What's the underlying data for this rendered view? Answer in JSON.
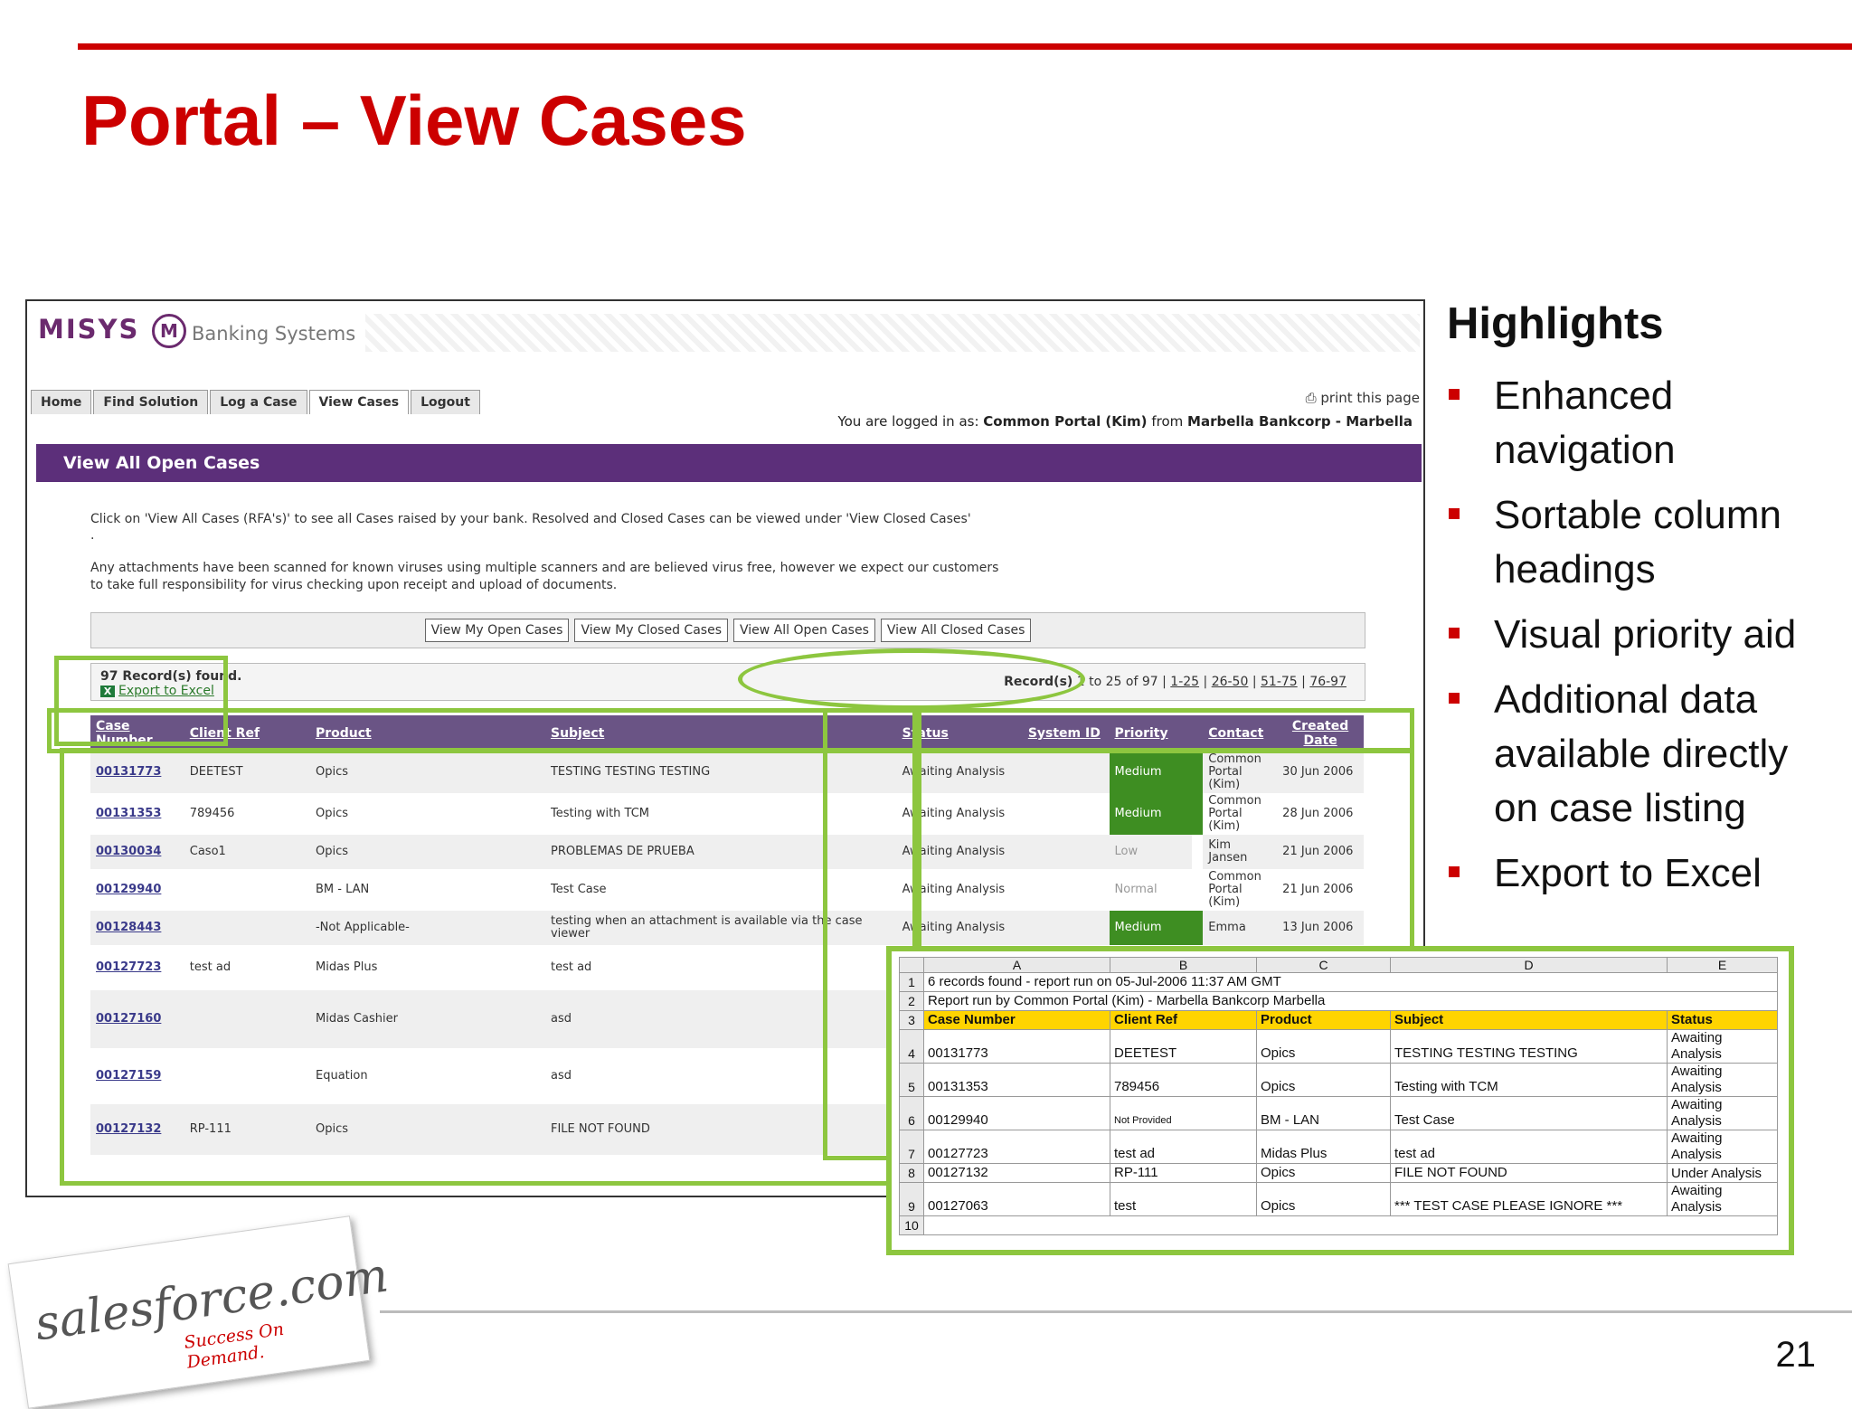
{
  "slide": {
    "title": "Portal – View Cases",
    "page_number": "21"
  },
  "portal": {
    "logo_text": "MISYS",
    "logo_mark": "M",
    "logo_subtitle": "Banking Systems",
    "tabs": [
      "Home",
      "Find Solution",
      "Log a Case",
      "View Cases",
      "Logout"
    ],
    "active_tab": "View Cases",
    "print_label": "print this page",
    "logged_in_prefix": "You are logged in as:",
    "logged_in_user": "Common Portal (Kim)",
    "logged_in_from": "from",
    "logged_in_org": "Marbella Bankcorp - Marbella",
    "section_title": "View All Open Cases",
    "intro_text": "Click on 'View All Cases (RFA's)' to see all Cases raised by your bank. Resolved and Closed Cases can be viewed under 'View Closed Cases'",
    "intro_dot": ".",
    "virus_text": "Any attachments have been scanned for known viruses using multiple scanners and are believed virus free, however we expect our customers to take full responsibility for virus checking upon receipt and upload of documents.",
    "view_buttons": [
      "View My Open Cases",
      "View My Closed Cases",
      "View All Open Cases",
      "View All Closed Cases"
    ],
    "records_found": "97 Record(s) found.",
    "export_label": "Export to Excel",
    "pager_prefix": "Record(s)",
    "pager_range": "1 to 25 of 97",
    "pager_links": [
      "1-25",
      "26-50",
      "51-75",
      "76-97"
    ],
    "columns": [
      "Case Number",
      "Client Ref",
      "Product",
      "Subject",
      "Status",
      "System ID",
      "Priority",
      "Contact",
      "Created Date"
    ],
    "rows": [
      {
        "number": "00131773",
        "client_ref": "DEETEST",
        "product": "Opics",
        "subject": "TESTING TESTING TESTING",
        "status": "Awaiting Analysis",
        "system_id": "",
        "priority": "Medium",
        "priority_level": "high",
        "contact": "Common Portal (Kim)",
        "created": "30 Jun 2006"
      },
      {
        "number": "00131353",
        "client_ref": "789456",
        "product": "Opics",
        "subject": "Testing with TCM",
        "status": "Awaiting Analysis",
        "system_id": "",
        "priority": "Medium",
        "priority_level": "high",
        "contact": "Common Portal (Kim)",
        "created": "28 Jun 2006"
      },
      {
        "number": "00130034",
        "client_ref": "Caso1",
        "product": "Opics",
        "subject": "PROBLEMAS DE PRUEBA",
        "status": "Awaiting Analysis",
        "system_id": "",
        "priority": "Low",
        "priority_level": "low",
        "contact": "Kim Jansen",
        "created": "21 Jun 2006"
      },
      {
        "number": "00129940",
        "client_ref": "",
        "product": "BM - LAN",
        "subject": "Test Case",
        "status": "Awaiting Analysis",
        "system_id": "",
        "priority": "Normal",
        "priority_level": "low",
        "contact": "Common Portal (Kim)",
        "created": "21 Jun 2006"
      },
      {
        "number": "00128443",
        "client_ref": "",
        "product": "-Not Applicable-",
        "subject": "testing when an attachment is available via the case viewer",
        "status": "Awaiting Analysis",
        "system_id": "",
        "priority": "Medium",
        "priority_level": "high",
        "contact": "Emma",
        "created": "13 Jun 2006"
      },
      {
        "number": "00127723",
        "client_ref": "test ad",
        "product": "Midas Plus",
        "subject": "test ad",
        "status": "",
        "system_id": "",
        "priority": "",
        "priority_level": "none",
        "contact": "",
        "created": ""
      },
      {
        "number": "00127160",
        "client_ref": "",
        "product": "Midas Cashier",
        "subject": "asd",
        "status": "",
        "system_id": "",
        "priority": "",
        "priority_level": "none",
        "contact": "",
        "created": ""
      },
      {
        "number": "00127159",
        "client_ref": "",
        "product": "Equation",
        "subject": "asd",
        "status": "",
        "system_id": "",
        "priority": "",
        "priority_level": "none",
        "contact": "",
        "created": ""
      },
      {
        "number": "00127132",
        "client_ref": "RP-111",
        "product": "Opics",
        "subject": "FILE NOT FOUND",
        "status": "",
        "system_id": "",
        "priority": "",
        "priority_level": "none",
        "contact": "",
        "created": ""
      }
    ]
  },
  "excel": {
    "col_letters": [
      "A",
      "B",
      "C",
      "D",
      "E"
    ],
    "line1": "6 records found - report run on 05-Jul-2006 11:37 AM GMT",
    "line2": "Report run by Common Portal (Kim) - Marbella Bankcorp Marbella",
    "headers": [
      "Case Number",
      "Client Ref",
      "Product",
      "Subject",
      "Status"
    ],
    "rows": [
      {
        "rownum": "4",
        "cells": [
          "00131773",
          "DEETEST",
          "Opics",
          "TESTING TESTING TESTING"
        ],
        "status": [
          "Awaiting",
          "Analysis"
        ]
      },
      {
        "rownum": "5",
        "cells": [
          "00131353",
          "789456",
          "Opics",
          "Testing with TCM"
        ],
        "status": [
          "Awaiting",
          "Analysis"
        ]
      },
      {
        "rownum": "6",
        "cells": [
          "00129940",
          "Not Provided",
          "BM - LAN",
          "Test Case"
        ],
        "status": [
          "Awaiting",
          "Analysis"
        ]
      },
      {
        "rownum": "7",
        "cells": [
          "00127723",
          "test ad",
          "Midas Plus",
          "test ad"
        ],
        "status": [
          "Awaiting",
          "Analysis"
        ]
      },
      {
        "rownum": "8",
        "cells": [
          "00127132",
          "RP-111",
          "Opics",
          "FILE NOT FOUND"
        ],
        "status": [
          "Under Analysis",
          ""
        ]
      },
      {
        "rownum": "9",
        "cells": [
          "00127063",
          "test",
          "Opics",
          "*** TEST CASE PLEASE IGNORE ***"
        ],
        "status": [
          "Awaiting",
          "Analysis"
        ]
      }
    ],
    "last_row": "10"
  },
  "highlights": {
    "title": "Highlights",
    "items": [
      "Enhanced navigation",
      "Sortable column headings",
      "Visual priority aid",
      "Additional data available directly on case listing",
      "Export to Excel"
    ]
  },
  "footer": {
    "brand": "salesforce.com",
    "tagline": "Success On Demand."
  },
  "colors": {
    "accent_red": "#cc0000",
    "portal_purple": "#5c2f7a",
    "highlight_green": "#8dc63f",
    "priority_green": "#3e8e22"
  }
}
